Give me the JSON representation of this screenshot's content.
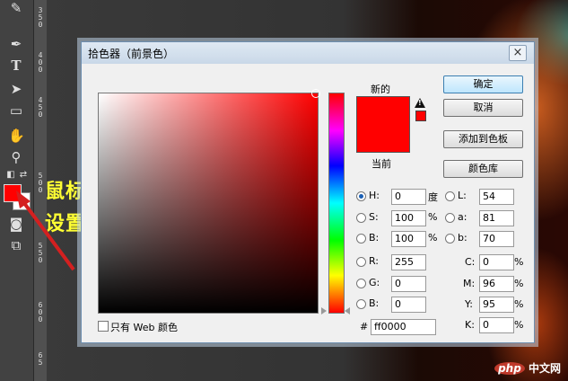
{
  "dialog": {
    "title": "拾色器（前景色）",
    "labels": {
      "new": "新的",
      "current": "当前"
    },
    "buttons": {
      "ok": "确定",
      "cancel": "取消",
      "add_to_swatches": "添加到色板",
      "color_libraries": "颜色库"
    },
    "hsb": {
      "h": {
        "label": "H:",
        "value": "0",
        "unit": "度"
      },
      "s": {
        "label": "S:",
        "value": "100",
        "unit": "%"
      },
      "b": {
        "label": "B:",
        "value": "100",
        "unit": "%"
      }
    },
    "rgb": {
      "r": {
        "label": "R:",
        "value": "255"
      },
      "g": {
        "label": "G:",
        "value": "0"
      },
      "b": {
        "label": "B:",
        "value": "0"
      }
    },
    "lab": {
      "l": {
        "label": "L:",
        "value": "54"
      },
      "a": {
        "label": "a:",
        "value": "81"
      },
      "b": {
        "label": "b:",
        "value": "70"
      }
    },
    "cmyk": {
      "c": {
        "label": "C:",
        "value": "0",
        "unit": "%"
      },
      "m": {
        "label": "M:",
        "value": "96",
        "unit": "%"
      },
      "y": {
        "label": "Y:",
        "value": "95",
        "unit": "%"
      },
      "k": {
        "label": "K:",
        "value": "0",
        "unit": "%"
      }
    },
    "hex": {
      "label": "#",
      "value": "ff0000"
    },
    "web_only": "只有 Web 颜色",
    "close": "×"
  },
  "annotation": {
    "line1": "鼠标单击",
    "line2": "设置前景色"
  },
  "toolbar": {
    "foreground_color": "#ff0000",
    "background_color": "#ffffff"
  },
  "watermark": {
    "badge": "php",
    "text": "中文网"
  },
  "ruler": {
    "digits": [
      "3",
      "5",
      "0",
      "4",
      "0",
      "0",
      "4",
      "5",
      "0",
      "5",
      "0",
      "0",
      "5",
      "5",
      "0",
      "6",
      "0",
      "0",
      "6",
      "5"
    ]
  }
}
